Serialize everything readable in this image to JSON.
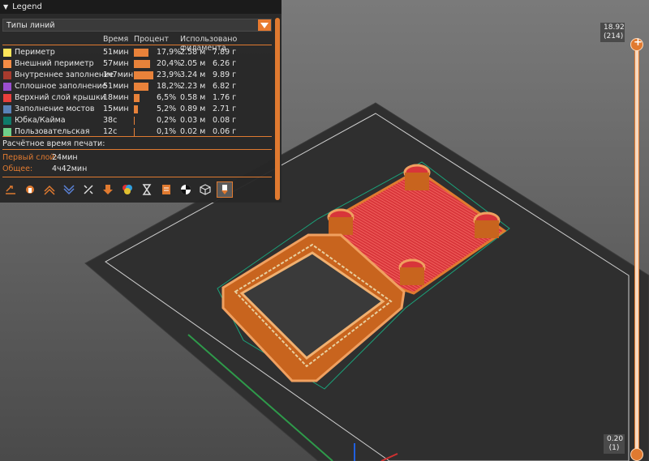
{
  "legend": {
    "title": "Legend",
    "view_type": "Типы линий",
    "headers": {
      "time": "Время",
      "percent": "Процент",
      "filament": "Использовано филамента"
    },
    "rows": [
      {
        "name": "Периметр",
        "color": "#ffe65a",
        "time": "51мин",
        "percent": "17,9%",
        "percent_value": 17.9,
        "length": "2.58 м",
        "weight": "7.89 г"
      },
      {
        "name": "Внешний периметр",
        "color": "#f58c45",
        "time": "57мин",
        "percent": "20,4%",
        "percent_value": 20.4,
        "length": "2.05 м",
        "weight": "6.26 г"
      },
      {
        "name": "Внутреннее заполнение",
        "color": "#a83b2e",
        "time": "1ч7мин",
        "percent": "23,9%",
        "percent_value": 23.9,
        "length": "3.24 м",
        "weight": "9.89 г"
      },
      {
        "name": "Сплошное заполнение",
        "color": "#9a4fd0",
        "time": "51мин",
        "percent": "18,2%",
        "percent_value": 18.2,
        "length": "2.23 м",
        "weight": "6.82 г"
      },
      {
        "name": "Верхний слой крышки",
        "color": "#e8403c",
        "time": "18мин",
        "percent": "6,5%",
        "percent_value": 6.5,
        "length": "0.58 м",
        "weight": "1.76 г"
      },
      {
        "name": "Заполнение мостов",
        "color": "#5a82b8",
        "time": "15мин",
        "percent": "5,2%",
        "percent_value": 5.2,
        "length": "0.89 м",
        "weight": "2.71 г"
      },
      {
        "name": "Юбка/Кайма",
        "color": "#0f7a6a",
        "time": "38с",
        "percent": "0,2%",
        "percent_value": 0.2,
        "length": "0.03 м",
        "weight": "0.08 г"
      },
      {
        "name": "Пользовательская",
        "color": "#6fd08a",
        "time": "12с",
        "percent": "0,1%",
        "percent_value": 0.1,
        "length": "0.02 м",
        "weight": "0.06 г"
      }
    ],
    "estimate_title": "Расчётное время печати:",
    "first_layer_label": "Первый слой:",
    "first_layer_value": "24мин",
    "total_label": "Общее:",
    "total_value": "4ч42мин",
    "toolbar_icons": [
      "travel-icon",
      "wipe-icon",
      "retractions-icon",
      "deretractions-icon",
      "seams-icon",
      "tool-changes-icon",
      "color-changes-icon",
      "pause-icon",
      "custom-gcode-icon",
      "center-of-gravity-icon",
      "shells-icon",
      "tool-marker-icon"
    ]
  },
  "layer_slider": {
    "top_value": "18.92",
    "top_layer": "(214)",
    "bottom_value": "0.20",
    "bottom_layer": "(1)",
    "accent": "#e07a30"
  }
}
